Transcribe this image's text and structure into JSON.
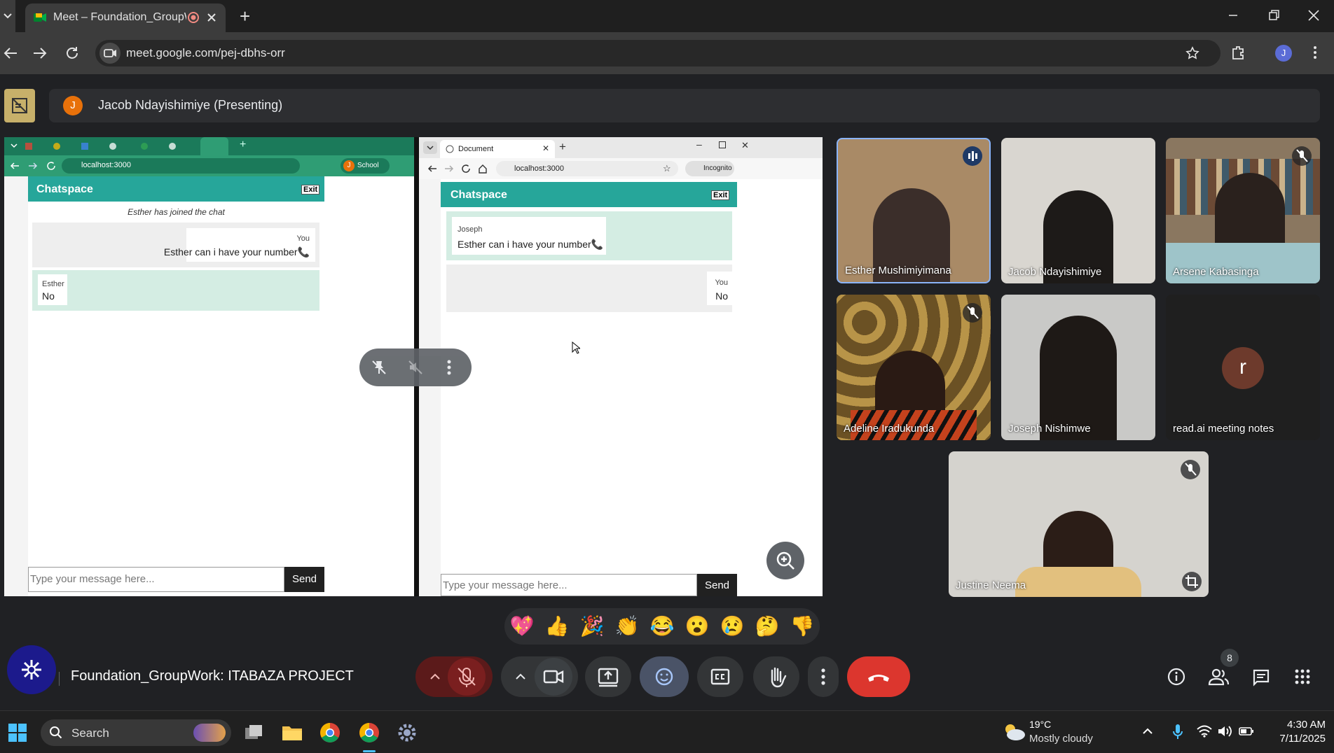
{
  "browser": {
    "tab_title": "Meet – Foundation_GroupW",
    "new_tab": "+",
    "url": "meet.google.com/pej-dbhs-orr",
    "profile_initial": "J"
  },
  "meet": {
    "presenter_initial": "J",
    "presenter_label": "Jacob Ndayishimiye (Presenting)",
    "meeting_title": "Foundation_GroupWork: ITABAZA PROJECT",
    "people_count": "8",
    "participants": [
      {
        "name": "Esther Mushimiyimana"
      },
      {
        "name": "Jacob Ndayishimiye"
      },
      {
        "name": "Arsene Kabasinga"
      },
      {
        "name": "Adeline Iradukunda"
      },
      {
        "name": "Joseph Nishimwe"
      },
      {
        "name": "read.ai meeting notes",
        "initial": "r"
      },
      {
        "name": "Justine Neema"
      }
    ],
    "reactions": [
      "💖",
      "👍",
      "🎉",
      "👏",
      "😂",
      "😮",
      "😢",
      "🤔",
      "👎"
    ]
  },
  "left_window": {
    "url": "localhost:3000",
    "profile": "School",
    "profile_initial": "J",
    "app_title": "Chatspace",
    "exit": "Exit",
    "system_msg": "Esther has joined the chat",
    "msg1_who": "You",
    "msg1_text": "Esther can i have your number📞",
    "msg2_who": "Esther",
    "msg2_text": "No",
    "placeholder": "Type your message here...",
    "send": "Send"
  },
  "right_window": {
    "tab_title": "Document",
    "url": "localhost:3000",
    "incognito": "Incognito",
    "app_title": "Chatspace",
    "exit": "Exit",
    "msg1_who": "Joseph",
    "msg1_text": "Esther can i have your number📞",
    "msg2_who": "You",
    "msg2_text": "No",
    "placeholder": "Type your message here...",
    "send": "Send"
  },
  "taskbar": {
    "search": "Search",
    "weather_temp": "19°C",
    "weather_desc": "Mostly cloudy",
    "time": "4:30 AM",
    "date": "7/11/2025"
  },
  "colors": {
    "end_call": "#dc362e",
    "mic_off": "#5b1a1a",
    "teal": "#26a69a",
    "accent": "#8ab4f8"
  }
}
